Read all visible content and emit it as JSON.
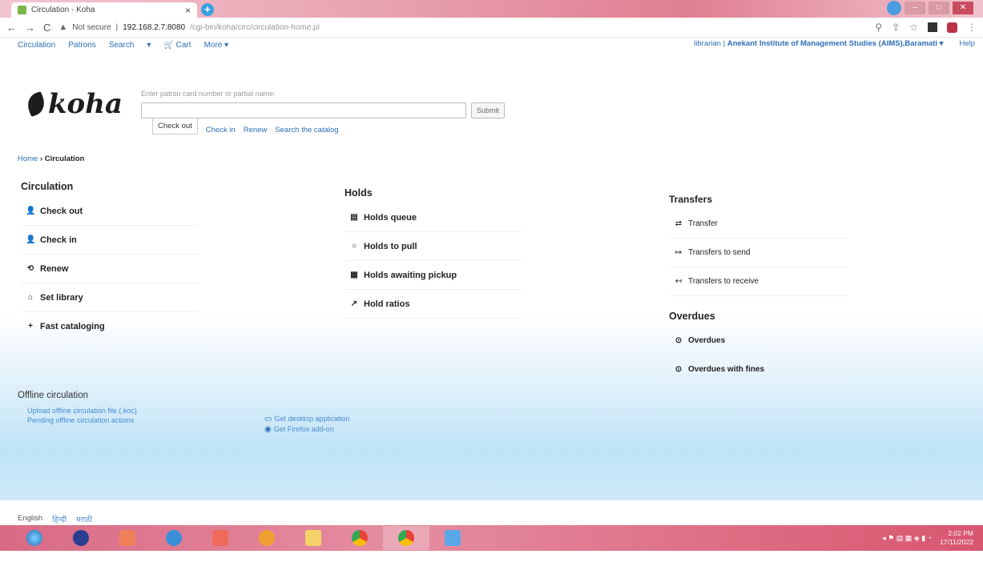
{
  "browser": {
    "tab_title": "Circulation - Koha",
    "tab_close": "×",
    "new_tab": "+",
    "url_warning": "Not secure",
    "url_host": "192.168.2.7:8080",
    "url_path": "/cgi-bin/koha/circ/circulation-home.pl"
  },
  "topnav": {
    "items": [
      "Circulation",
      "Patrons",
      "Search",
      "▾",
      "🛒 Cart",
      "More ▾"
    ],
    "user": "librarian",
    "library": "Anekant Institute of Management Studies (AIMS),Baramati ▾",
    "help": "Help"
  },
  "logo": {
    "text": "koha"
  },
  "search": {
    "hint": "Enter patron card number or partial name:",
    "submit": "Submit",
    "tabs": [
      "Check out",
      "Check in",
      "Renew",
      "Search the catalog"
    ]
  },
  "breadcrumb": {
    "home": "Home",
    "sep": "›",
    "current": "Circulation"
  },
  "circulation": {
    "heading": "Circulation",
    "items": [
      "Check out",
      "Check in",
      "Renew",
      "Set library",
      "Fast cataloging"
    ]
  },
  "holds": {
    "heading": "Holds",
    "items": [
      "Holds queue",
      "Holds to pull",
      "Holds awaiting pickup",
      "Hold ratios"
    ]
  },
  "transfers": {
    "heading": "Transfers",
    "items": [
      "Transfer",
      "Transfers to send",
      "Transfers to receive"
    ]
  },
  "overdues": {
    "heading": "Overdues",
    "items": [
      "Overdues",
      "Overdues with fines"
    ]
  },
  "offline": {
    "heading": "Offline circulation",
    "links": [
      "Upload offline circulation file (.koc)",
      "Pending offline circulation actions"
    ],
    "links2": [
      "Get desktop application",
      "Get Firefox add-on"
    ]
  },
  "languages": [
    "English",
    "हिन्दी",
    "मराठी"
  ],
  "taskbar": {
    "time": "2:02 PM",
    "date": "17/11/2022"
  }
}
